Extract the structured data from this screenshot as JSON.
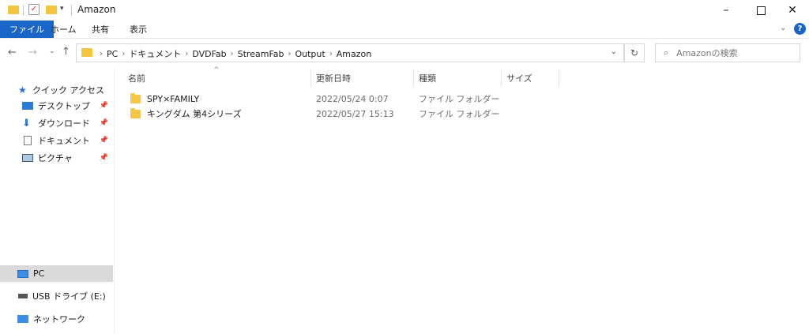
{
  "window": {
    "title": "Amazon"
  },
  "ribbon": {
    "tabs": [
      "ファイル",
      "ホーム",
      "共有",
      "表示"
    ]
  },
  "address": {
    "crumbs": [
      "PC",
      "ドキュメント",
      "DVDFab",
      "StreamFab",
      "Output",
      "Amazon"
    ]
  },
  "search": {
    "placeholder": "Amazonの検索"
  },
  "nav": {
    "quick_access": "クイック アクセス",
    "items": [
      "デスクトップ",
      "ダウンロード",
      "ドキュメント",
      "ピクチャ"
    ],
    "pc": "PC",
    "usb": "USB ドライブ (E:)",
    "network": "ネットワーク"
  },
  "columns": {
    "name": "名前",
    "modified": "更新日時",
    "type": "種類",
    "size": "サイズ"
  },
  "files": [
    {
      "name": "SPY×FAMILY",
      "modified": "2022/05/24 0:07",
      "type": "ファイル フォルダー"
    },
    {
      "name": "キングダム 第4シリーズ",
      "modified": "2022/05/27 15:13",
      "type": "ファイル フォルダー"
    }
  ],
  "colors": {
    "accent": "#1a66c8",
    "folder": "#f6c644",
    "selection": "#dadada"
  }
}
